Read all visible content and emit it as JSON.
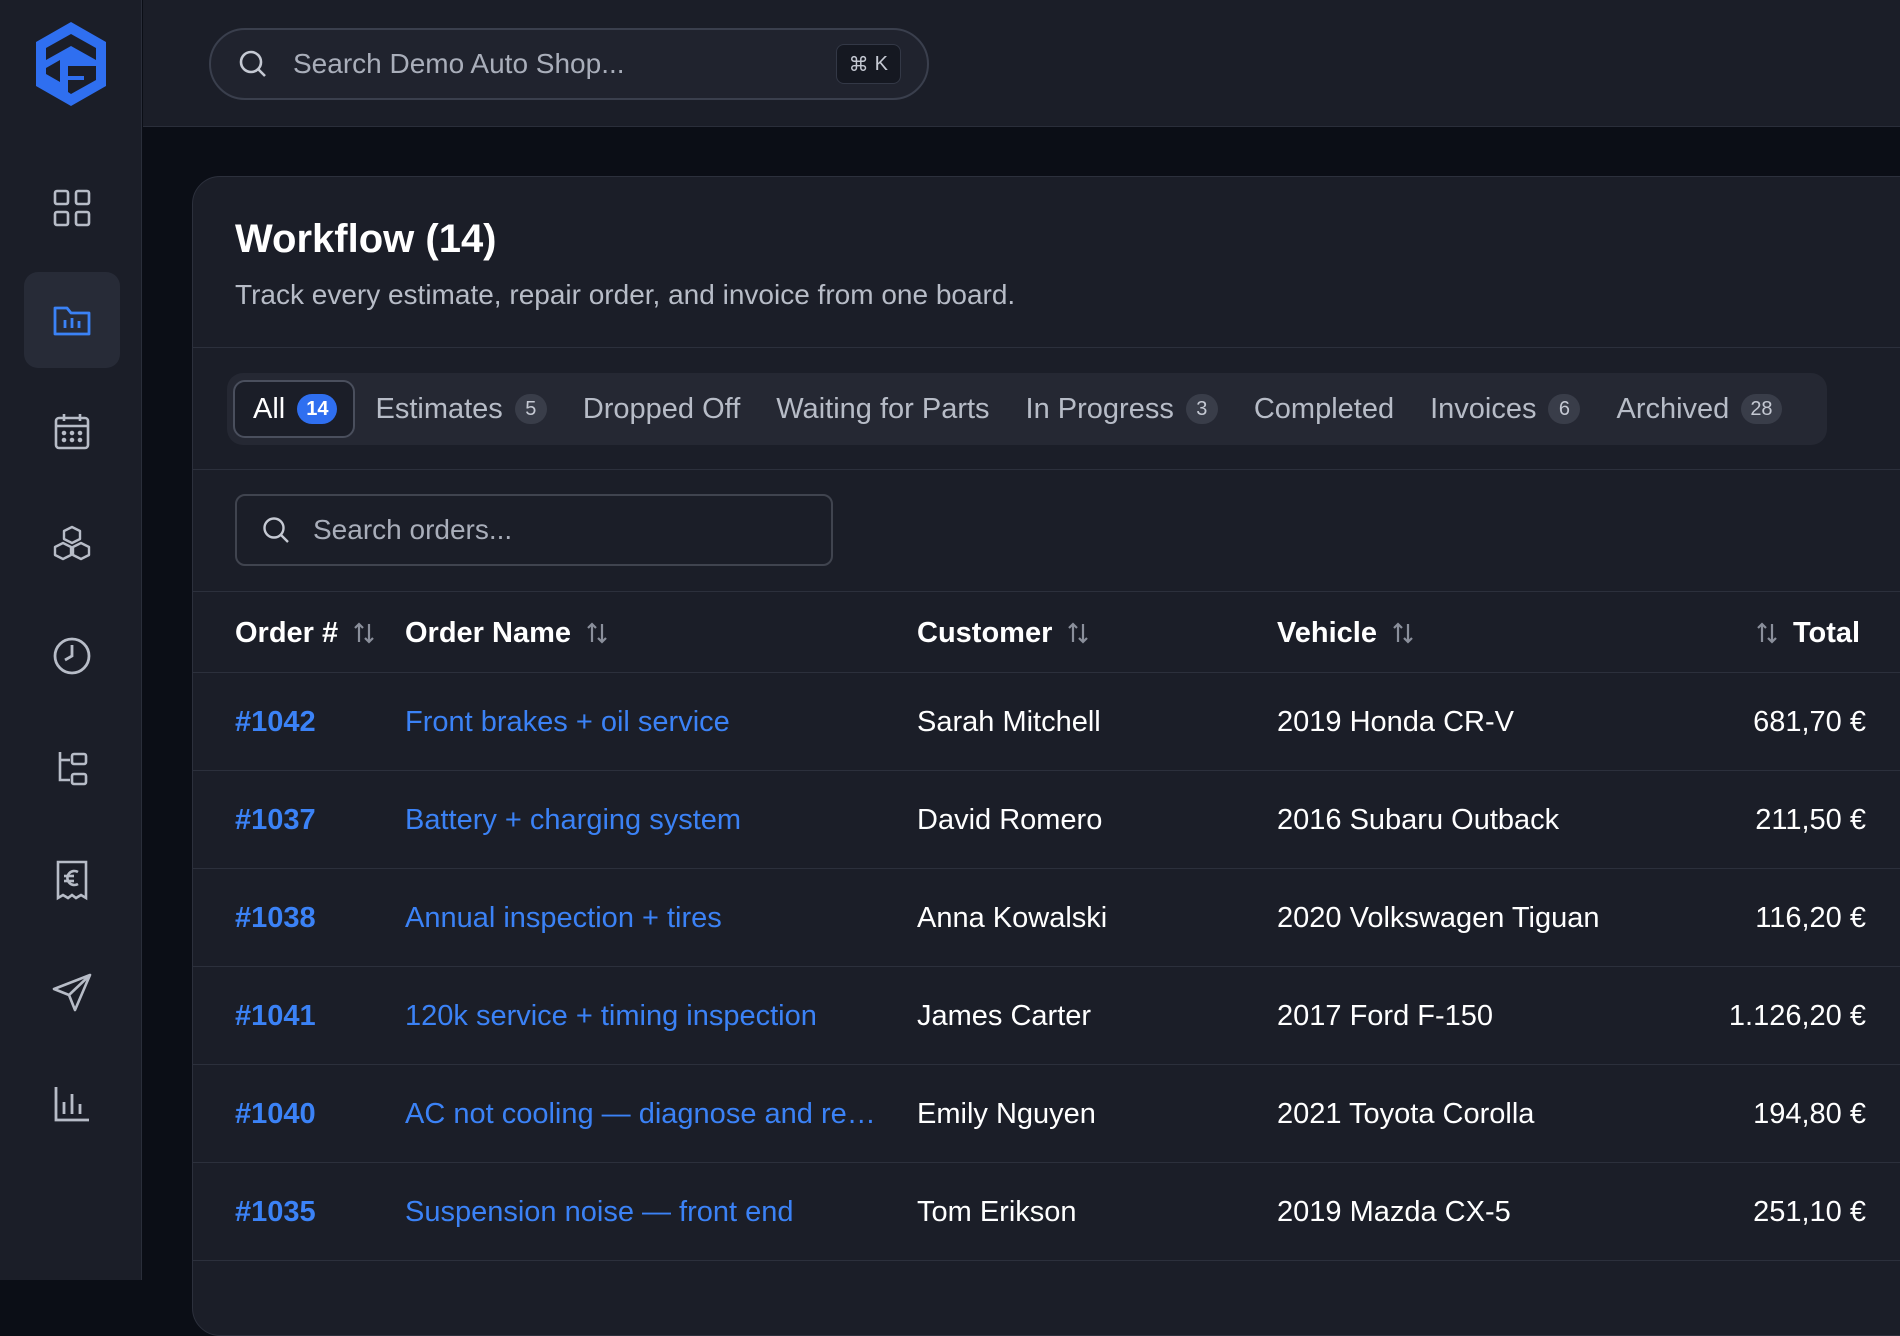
{
  "app": {
    "search_placeholder": "Search Demo Auto Shop...",
    "search_shortcut_symbol": "⌘",
    "search_shortcut_key": "K",
    "accent_color": "#3b82f6"
  },
  "sidebar": {
    "items": [
      {
        "icon": "dashboard-grid-icon",
        "active": false
      },
      {
        "icon": "workflow-folder-icon",
        "active": true
      },
      {
        "icon": "calendar-icon",
        "active": false
      },
      {
        "icon": "inventory-boxes-icon",
        "active": false
      },
      {
        "icon": "clock-icon",
        "active": false
      },
      {
        "icon": "hierarchy-icon",
        "active": false
      },
      {
        "icon": "euro-receipt-icon",
        "active": false
      },
      {
        "icon": "send-icon",
        "active": false
      },
      {
        "icon": "bar-chart-icon",
        "active": false
      }
    ]
  },
  "page": {
    "title": "Workflow (14)",
    "subtitle": "Track every estimate, repair order, and invoice from one board."
  },
  "tabs": [
    {
      "label": "All",
      "count": "14",
      "active": true
    },
    {
      "label": "Estimates",
      "count": "5"
    },
    {
      "label": "Dropped Off",
      "count": ""
    },
    {
      "label": "Waiting for Parts",
      "count": ""
    },
    {
      "label": "In Progress",
      "count": "3"
    },
    {
      "label": "Completed",
      "count": ""
    },
    {
      "label": "Invoices",
      "count": "6"
    },
    {
      "label": "Archived",
      "count": "28"
    }
  ],
  "orders_search": {
    "placeholder": "Search orders..."
  },
  "table": {
    "columns": {
      "order_no": "Order #",
      "order_name": "Order Name",
      "customer": "Customer",
      "vehicle": "Vehicle",
      "total": "Total"
    },
    "rows": [
      {
        "order_no": "#1042",
        "order_name": "Front brakes + oil service",
        "customer": "Sarah Mitchell",
        "vehicle": "2019 Honda CR-V",
        "total": "681,70 €"
      },
      {
        "order_no": "#1037",
        "order_name": "Battery + charging system",
        "customer": "David Romero",
        "vehicle": "2016 Subaru Outback",
        "total": "211,50 €"
      },
      {
        "order_no": "#1038",
        "order_name": "Annual inspection + tires",
        "customer": "Anna Kowalski",
        "vehicle": "2020 Volkswagen Tiguan",
        "total": "116,20 €"
      },
      {
        "order_no": "#1041",
        "order_name": "120k service + timing inspection",
        "customer": "James Carter",
        "vehicle": "2017 Ford F-150",
        "total": "1.126,20 €"
      },
      {
        "order_no": "#1040",
        "order_name": "AC not cooling — diagnose and rech...",
        "customer": "Emily Nguyen",
        "vehicle": "2021 Toyota Corolla",
        "total": "194,80 €"
      },
      {
        "order_no": "#1035",
        "order_name": "Suspension noise — front end",
        "customer": "Tom Erikson",
        "vehicle": "2019 Mazda CX-5",
        "total": "251,10 €"
      }
    ]
  }
}
